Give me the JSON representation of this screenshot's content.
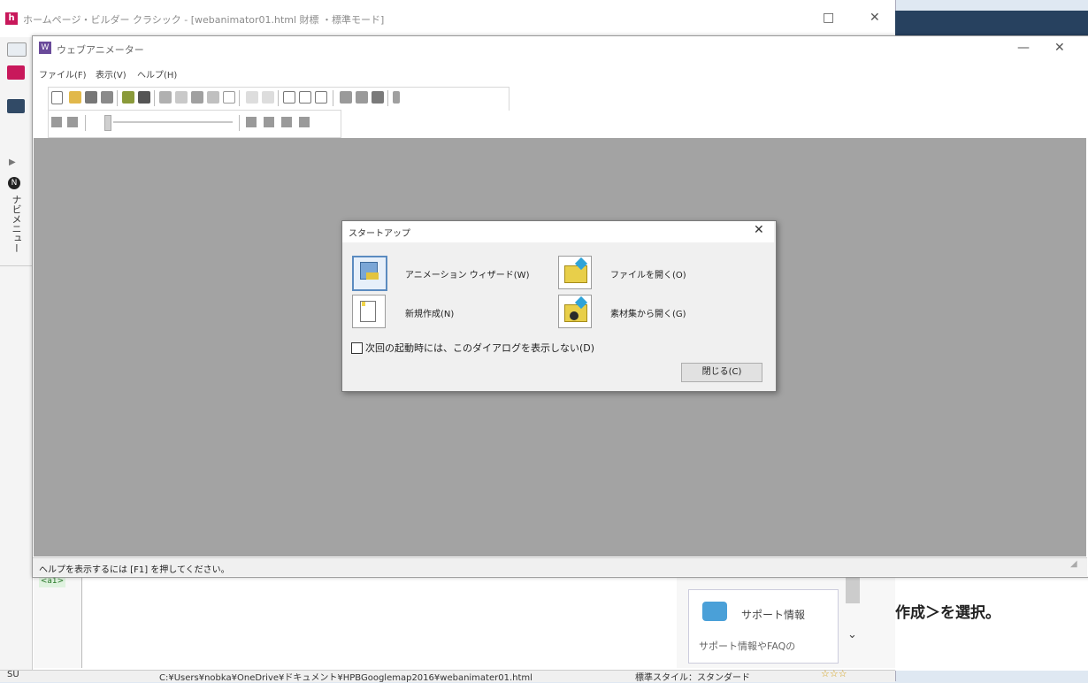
{
  "outer_window": {
    "title": "ホームページ・ビルダー クラシック - [webanimator01.html 財標 ・標準モード]",
    "app_icon": "h",
    "minimize_label": "□",
    "close_label": "✕",
    "nav_badge": "N",
    "nav_label": "ナビメニュー",
    "lower_tag": "<a1>",
    "support_title": "サポート情報",
    "support_desc": "サポート情報やFAQの",
    "background_text": "作成＞を選択。",
    "status": {
      "left": "SU",
      "path": "C:¥Users¥nobka¥OneDrive¥ドキュメント¥HPBGooglemap2016¥webanimater01.html",
      "style": "標準スタイル：スタンダード",
      "stars": "☆☆☆"
    }
  },
  "animator_window": {
    "title": "ウェブアニメーター",
    "icon": "W",
    "min_label": "—",
    "close_label": "✕",
    "menus": [
      "ファイル(F)",
      "表示(V)",
      "ヘルプ(H)"
    ],
    "status_text": "ヘルプを表示するには [F1] を押してください。"
  },
  "startup_dialog": {
    "title": "スタートアップ",
    "close_label": "✕",
    "options": {
      "wizard": "アニメーション ウィザード(W)",
      "new": "新規作成(N)",
      "open": "ファイルを開く(O)",
      "material": "素材集から開く(G)"
    },
    "checkbox_label": "次回の起動時には、このダイアログを表示しない(D)",
    "checkbox_checked": false,
    "close_button": "閉じる(C)"
  },
  "colors": {
    "stage_gray": "#a3a3a3",
    "brand_pink": "#c8185b",
    "dialog_bg": "#f0f0f0"
  }
}
